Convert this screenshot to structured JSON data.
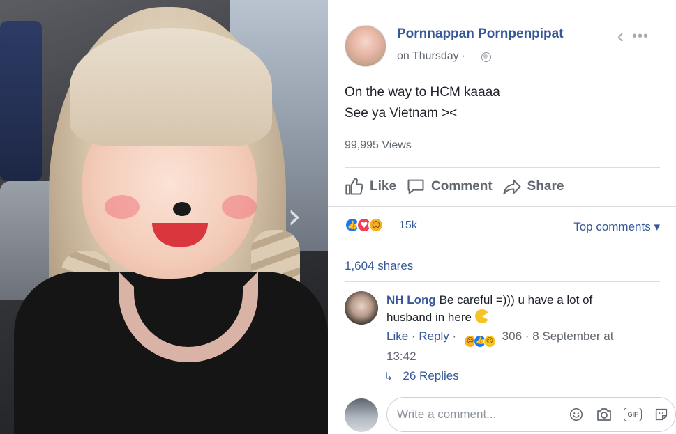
{
  "post": {
    "author": "Pornnappan Pornpenpipat",
    "time": "on Thursday",
    "separator": "·",
    "text_line1": "On the way to HCM kaaaa",
    "text_line2": "See ya Vietnam ><",
    "views": "99,995 Views"
  },
  "header_icons": {
    "back": "‹",
    "more": "•••"
  },
  "actions": {
    "like": "Like",
    "comment": "Comment",
    "share": "Share"
  },
  "reactions": {
    "count": "15k",
    "top_comments": "Top comments ▾"
  },
  "shares": "1,604 shares",
  "comment": {
    "name": "NH Long",
    "text": "Be careful =))) u have a lot of husband in here",
    "like": "Like",
    "reply": "Reply",
    "reaction_count": "306",
    "timestamp": "8 September at 13:42",
    "sep": "·"
  },
  "replies": {
    "label": "26 Replies",
    "arrow": "↳"
  },
  "composer": {
    "placeholder": "Write a comment...",
    "gif": "GIF"
  },
  "colors": {
    "link": "#365899",
    "muted": "#616770",
    "like_blue": "#1877f2",
    "love_red": "#f33e58",
    "haha_yellow": "#f7b125"
  },
  "photo": {
    "next_arrow": "›"
  }
}
